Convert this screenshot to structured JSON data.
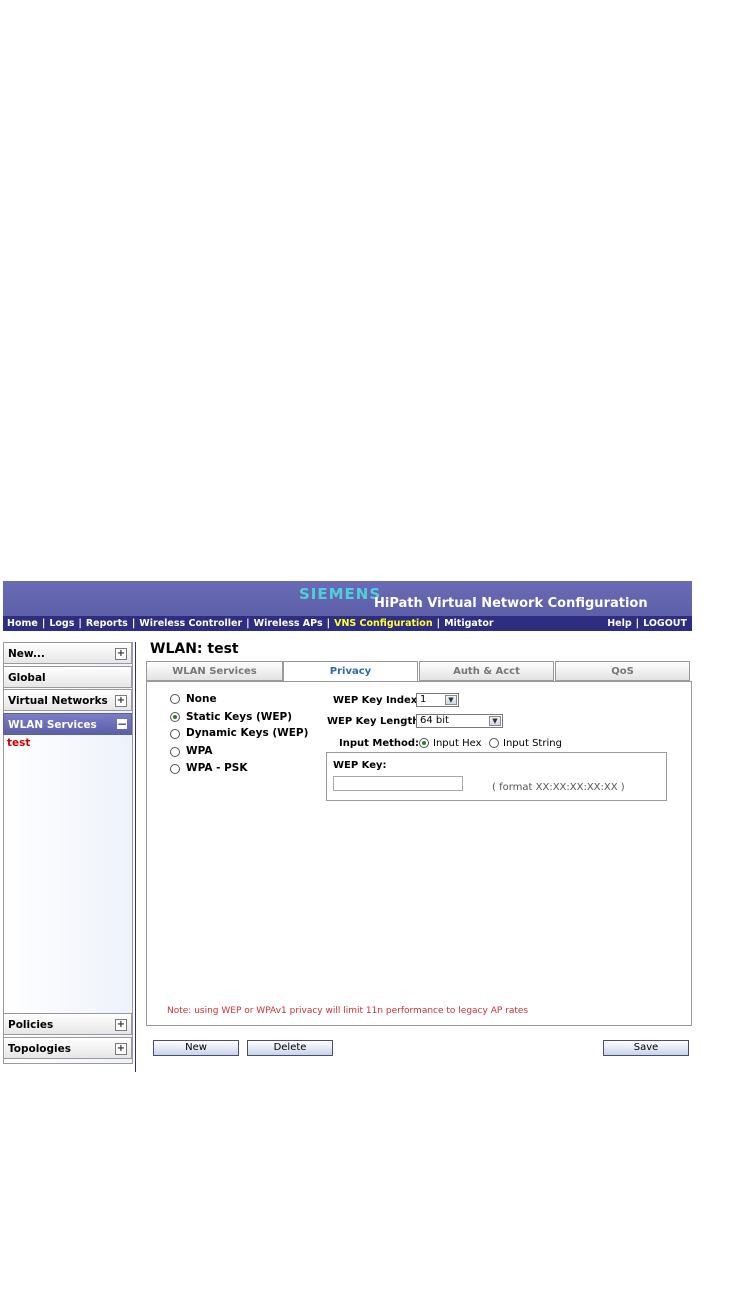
{
  "header": {
    "brand": "SIEMENS",
    "title": "HiPath Virtual Network Configuration"
  },
  "nav": {
    "items": [
      "Home",
      "Logs",
      "Reports",
      "Wireless Controller",
      "Wireless APs",
      "VNS Configuration",
      "Mitigator"
    ],
    "active": "VNS Configuration",
    "right": [
      "Help",
      "LOGOUT"
    ],
    "separator": "|"
  },
  "sidebar": {
    "items": [
      "New...",
      "Global",
      "Virtual Networks",
      "WLAN Services",
      "Policies",
      "Topologies"
    ],
    "active": "WLAN Services",
    "sub_items": [
      "test"
    ]
  },
  "page": {
    "title": "WLAN: test"
  },
  "tabs": [
    "WLAN Services",
    "Privacy",
    "Auth & Acct",
    "QoS"
  ],
  "active_tab": "Privacy",
  "privacy": {
    "options": [
      "None",
      "Static Keys (WEP)",
      "Dynamic Keys (WEP)",
      "WPA",
      "WPA - PSK"
    ],
    "selected": "Static Keys (WEP)",
    "wep_key_index_label": "WEP Key Index:",
    "wep_key_index_value": "1",
    "wep_key_length_label": "WEP Key Length:",
    "wep_key_length_value": "64 bit",
    "input_method_label": "Input Method:",
    "input_methods": [
      "Input Hex",
      "Input String"
    ],
    "input_method_selected": "Input Hex",
    "wep_key_label": "WEP Key:",
    "wep_key_value": "",
    "format_hint": "( format XX:XX:XX:XX:XX )",
    "note": "Note: using WEP or WPAv1 privacy will limit 11n performance to legacy AP rates"
  },
  "buttons": {
    "new": "New",
    "delete": "Delete",
    "save": "Save"
  },
  "colors": {
    "banner": "#5d5fa9",
    "navbar": "#2e2d82",
    "active_nav": "#ffff33",
    "brand": "#4fd0d8",
    "note": "#cc3333",
    "sub_item": "#cc0000"
  },
  "icons": {
    "expand": "plus-icon",
    "collapse": "minus-icon",
    "dropdown": "chevron-down-icon"
  }
}
